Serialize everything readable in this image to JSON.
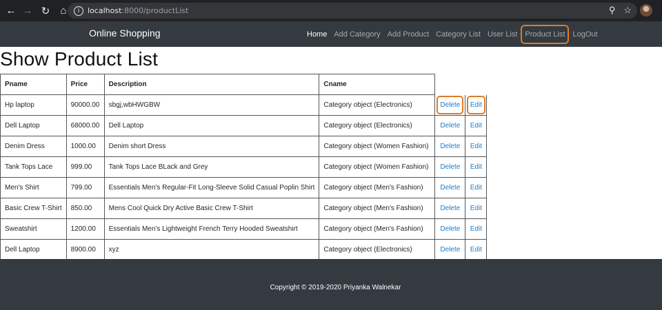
{
  "browser": {
    "url_host": "localhost",
    "url_rest": ":8000/productList",
    "icons": [
      "back-arrow-icon",
      "forward-arrow-icon",
      "reload-icon",
      "home-icon",
      "info-icon",
      "zoom-icon",
      "star-icon"
    ]
  },
  "navbar": {
    "brand": "Online Shopping",
    "items": [
      "Home",
      "Add Category",
      "Add Product",
      "Category List",
      "User List",
      "Product List",
      "LogOut"
    ]
  },
  "page": {
    "title": "Show Product List"
  },
  "table": {
    "headers": [
      "Pname",
      "Price",
      "Description",
      "Cname"
    ],
    "delete_label": "Delete",
    "edit_label": "Edit",
    "rows": [
      [
        "Hp laptop",
        "90000.00",
        "sbgj,wbHWGBW",
        "Category object (Electronics)"
      ],
      [
        "Dell Laptop",
        "68000.00",
        "Dell Laptop",
        "Category object (Electronics)"
      ],
      [
        "Denim Dress",
        "1000.00",
        "Denim short Dress",
        "Category object (Women Fashion)"
      ],
      [
        "Tank Tops Lace",
        "999.00",
        "Tank Tops Lace BLack and Grey",
        "Category object (Women Fashion)"
      ],
      [
        "Men's Shirt",
        "799.00",
        "Essentials Men's Regular-Fit Long-Sleeve Solid Casual Poplin Shirt",
        "Category object (Men's Fashion)"
      ],
      [
        "Basic Crew T-Shirt",
        "850.00",
        "Mens Cool Quick Dry Active Basic Crew T-Shirt",
        "Category object (Men's Fashion)"
      ],
      [
        "Sweatshirt",
        "1200.00",
        "Essentials Men's Lightweight French Terry Hooded Sweatshirt",
        "Category object (Men's Fashion)"
      ],
      [
        "Dell Laptop",
        "8900.00",
        "xyz",
        "Category object (Electronics)"
      ]
    ]
  },
  "footer": {
    "copyright": "Copyright © 2019-2020 Priyanka Walnekar"
  },
  "colors": {
    "navbar_bg": "#343a40",
    "link": "#1e7bc8",
    "highlight": "#e07b25"
  }
}
